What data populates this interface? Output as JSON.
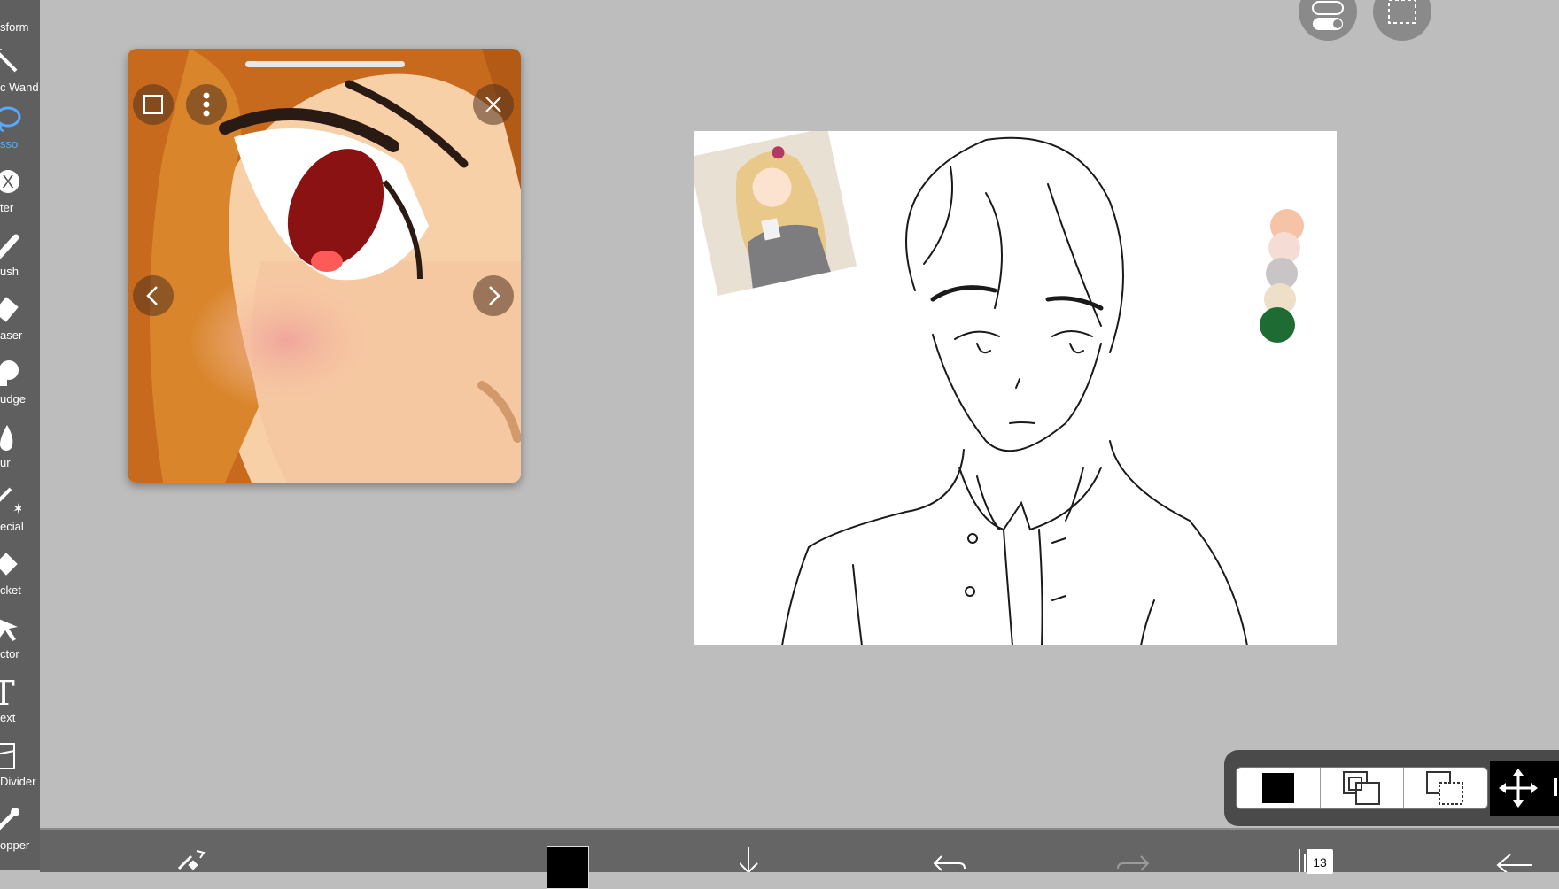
{
  "toolbar": {
    "items": [
      {
        "label": "sform",
        "icon": "transform-icon"
      },
      {
        "label": "c Wand",
        "icon": "magic-wand-icon"
      },
      {
        "label": "sso",
        "icon": "lasso-icon"
      },
      {
        "label": "ter",
        "icon": "filter-icon"
      },
      {
        "label": "ush",
        "icon": "brush-icon"
      },
      {
        "label": "aser",
        "icon": "eraser-icon"
      },
      {
        "label": "udge",
        "icon": "smudge-icon"
      },
      {
        "label": "ur",
        "icon": "blur-icon"
      },
      {
        "label": "ecial",
        "icon": "special-icon"
      },
      {
        "label": "cket",
        "icon": "bucket-icon"
      },
      {
        "label": "ctor",
        "icon": "vector-icon"
      },
      {
        "label": "ext",
        "icon": "text-icon"
      },
      {
        "label": "Divider",
        "icon": "frame-divider-icon"
      },
      {
        "label": "opper",
        "icon": "eyedropper-icon"
      }
    ],
    "active_index": 2,
    "active_color": "#5aa9ff"
  },
  "reference_viewer": {
    "buttons": [
      "fit-icon",
      "more-options-icon",
      "close-icon",
      "previous-icon",
      "next-icon"
    ]
  },
  "canvas": {
    "palette_colors": [
      "#f7c3a7",
      "#f5ddd5",
      "#c9c4c6",
      "#eedfc8",
      "#1f6b34"
    ]
  },
  "mode_bar": {
    "modes": [
      "normal-mode-icon",
      "add-mode-icon",
      "subtract-mode-icon"
    ],
    "move_icon": "move-icon"
  },
  "bottom_bar": {
    "layer_count": "13",
    "current_color": "#000000"
  }
}
